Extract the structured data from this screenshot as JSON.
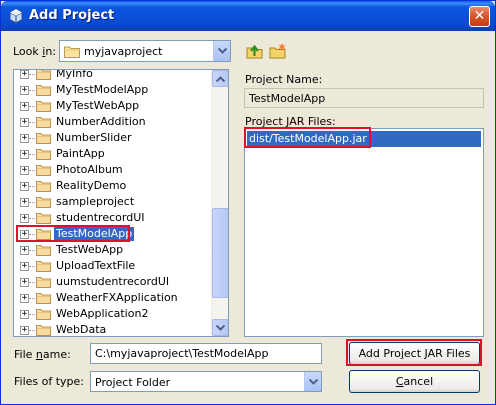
{
  "window": {
    "title": "Add Project",
    "close_glyph": "✕"
  },
  "look_in": {
    "label_pre": "Look ",
    "label_mn": "i",
    "label_post": "n:",
    "value": "myjavaproject",
    "icon": "folder-icon"
  },
  "toolbar": {
    "up_icon": "up-folder-icon",
    "new_folder_icon": "new-folder-icon"
  },
  "tree": {
    "items": [
      {
        "label": "MyInfo",
        "selected": false
      },
      {
        "label": "MyTestModelApp",
        "selected": false
      },
      {
        "label": "MyTestWebApp",
        "selected": false
      },
      {
        "label": "NumberAddition",
        "selected": false
      },
      {
        "label": "NumberSlider",
        "selected": false
      },
      {
        "label": "PaintApp",
        "selected": false
      },
      {
        "label": "PhotoAlbum",
        "selected": false
      },
      {
        "label": "RealityDemo",
        "selected": false
      },
      {
        "label": "sampleproject",
        "selected": false
      },
      {
        "label": "studentrecordUI",
        "selected": false
      },
      {
        "label": "TestModelApp",
        "selected": true
      },
      {
        "label": "TestWebApp",
        "selected": false
      },
      {
        "label": "UploadTextFile",
        "selected": false
      },
      {
        "label": "uumstudentrecordUI",
        "selected": false
      },
      {
        "label": "WeatherFXApplication",
        "selected": false
      },
      {
        "label": "WebApplication2",
        "selected": false
      },
      {
        "label": "WebData",
        "selected": false
      }
    ],
    "scroll_position": 0.85
  },
  "project_name": {
    "label": "Project Name:",
    "value": "TestModelApp"
  },
  "project_jars": {
    "label_pre": "Project ",
    "label_mn": "J",
    "label_post": "AR Files:",
    "items": [
      "dist/TestModelApp.jar"
    ]
  },
  "file_name": {
    "label_pre": "File ",
    "label_mn": "n",
    "label_post": "ame:",
    "value": "C:\\myjavaproject\\TestModelApp"
  },
  "files_of_type": {
    "label": "Files of type:",
    "value": "Project Folder"
  },
  "buttons": {
    "add_jar_pre": "Add Pro",
    "add_jar_mn": "j",
    "add_jar_post": "ect JAR Files",
    "cancel_mn": "C",
    "cancel_post": "ancel"
  },
  "colors": {
    "selection": "#316ac5",
    "highlight_box": "#e0102c",
    "titlebar": "#0a4fd6"
  }
}
